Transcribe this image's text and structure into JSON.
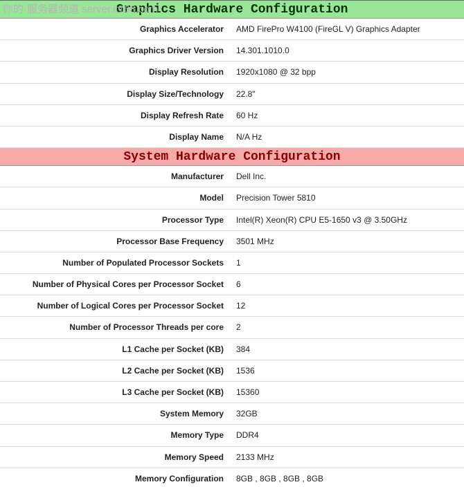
{
  "watermark": "你的·服务器频道 server.it168.com",
  "sections": [
    {
      "title": "Graphics Hardware Configuration",
      "color": "green",
      "rows": [
        {
          "label": "Graphics Accelerator",
          "value": "AMD FirePro W4100 (FireGL V) Graphics Adapter"
        },
        {
          "label": "Graphics Driver Version",
          "value": "14.301.1010.0"
        },
        {
          "label": "Display Resolution",
          "value": "1920x1080 @ 32 bpp"
        },
        {
          "label": "Display Size/Technology",
          "value": "22.8\""
        },
        {
          "label": "Display Refresh Rate",
          "value": "60 Hz"
        },
        {
          "label": "Display Name",
          "value": "N/A Hz"
        }
      ]
    },
    {
      "title": "System Hardware Configuration",
      "color": "pink",
      "rows": [
        {
          "label": "Manufacturer",
          "value": "Dell Inc."
        },
        {
          "label": "Model",
          "value": "Precision Tower 5810"
        },
        {
          "label": "Processor Type",
          "value": "Intel(R) Xeon(R) CPU E5-1650 v3 @ 3.50GHz"
        },
        {
          "label": "Processor Base Frequency",
          "value": "3501 MHz"
        },
        {
          "label": "Number of Populated Processor Sockets",
          "value": "1"
        },
        {
          "label": "Number of Physical Cores per Processor Socket",
          "value": "6"
        },
        {
          "label": "Number of Logical Cores per Processor Socket",
          "value": "12"
        },
        {
          "label": "Number of Processor Threads per core",
          "value": "2"
        },
        {
          "label": "L1 Cache per Socket (KB)",
          "value": "384"
        },
        {
          "label": "L2 Cache per Socket (KB)",
          "value": "1536"
        },
        {
          "label": "L3 Cache per Socket (KB)",
          "value": "15360"
        },
        {
          "label": "System Memory",
          "value": "32GB"
        },
        {
          "label": "Memory Type",
          "value": "DDR4"
        },
        {
          "label": "Memory Speed",
          "value": "2133 MHz"
        },
        {
          "label": "Memory Configuration",
          "value": "8GB , 8GB , 8GB , 8GB"
        }
      ]
    }
  ]
}
